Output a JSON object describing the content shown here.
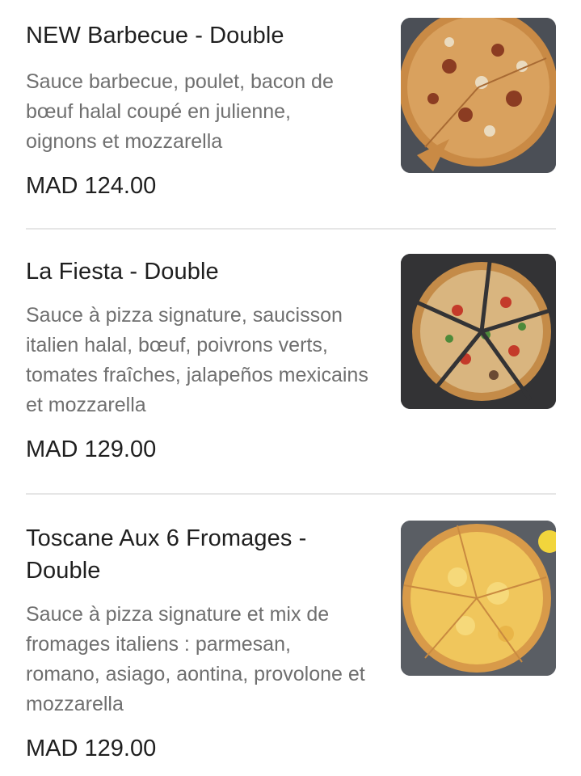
{
  "items": [
    {
      "title": "NEW Barbecue - Double",
      "description": "Sauce barbecue, poulet, bacon de bœuf halal coupé en julienne, oignons et mozzarella",
      "price": "MAD 124.00",
      "image_icon": "pizza-barbecue-image"
    },
    {
      "title": "La Fiesta - Double",
      "description": "Sauce à pizza signature, saucisson italien halal, bœuf, poivrons verts, tomates fraîches, jalapeños mexicains et mozzarella",
      "price": "MAD 129.00",
      "image_icon": "pizza-fiesta-image"
    },
    {
      "title": "Toscane Aux 6 Fromages - Double",
      "description": "Sauce à pizza signature et mix de fromages italiens : parmesan, romano, asiago, aontina, provolone et mozzarella",
      "price": "MAD 129.00",
      "image_icon": "pizza-toscane-image"
    }
  ],
  "colors": {
    "title": "#1f1f1f",
    "description": "#6f6f6f",
    "divider": "#e6e6e6"
  }
}
